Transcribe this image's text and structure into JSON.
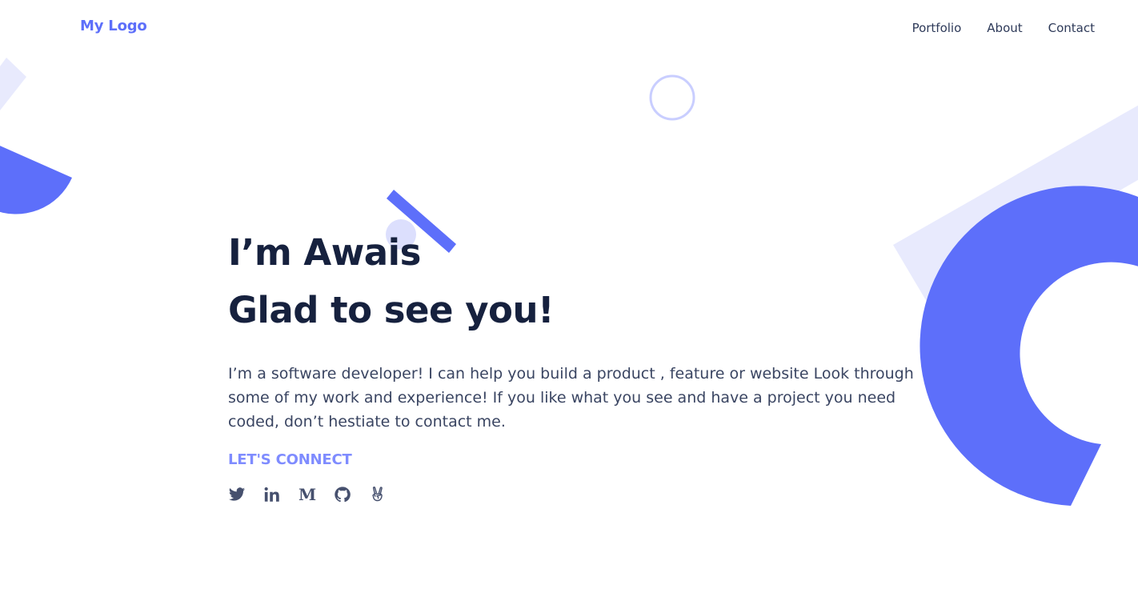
{
  "theme": {
    "accent": "#5d6ffa",
    "accent_light": "#e8eafd",
    "accent_mid": "#c9ceff",
    "heading": "#16213e",
    "text": "#3a4562",
    "icon": "#46506e"
  },
  "header": {
    "logo": "My Logo",
    "nav": [
      {
        "label": "Portfolio"
      },
      {
        "label": "About"
      },
      {
        "label": "Contact"
      }
    ]
  },
  "hero": {
    "title_line1": "I’m Awais",
    "title_line2": "Glad to see you!",
    "bio": "I’m a software developer! I can help you build a product , feature or website Look through some of my work and experience! If you like what you see and have a project you need coded, don’t hestiate to contact me.",
    "connect_label": "LET'S CONNECT"
  },
  "socials": [
    {
      "icon": "twitter-icon"
    },
    {
      "icon": "linkedin-icon"
    },
    {
      "icon": "medium-icon",
      "glyph": "M"
    },
    {
      "icon": "github-icon"
    },
    {
      "icon": "angellist-icon"
    }
  ]
}
